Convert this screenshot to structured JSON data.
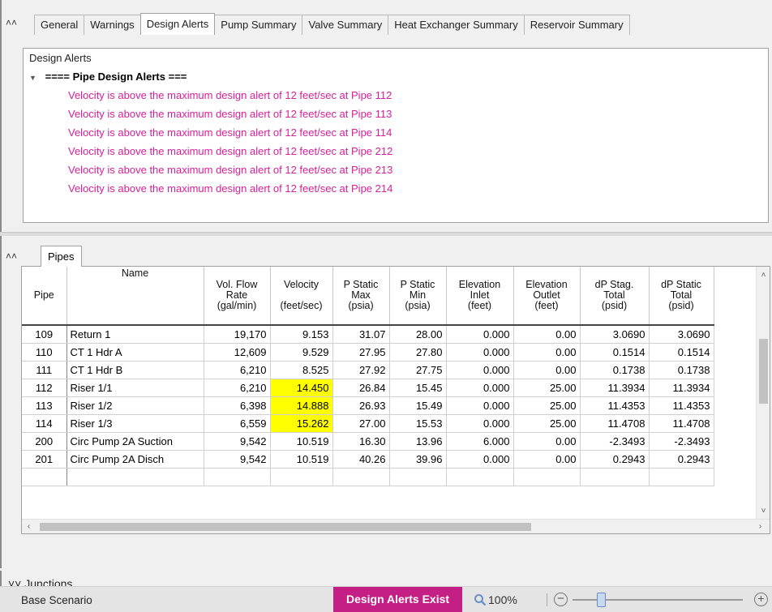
{
  "top_tabs": {
    "collapse_icon": "double-chevron-up-icon",
    "items": [
      {
        "label": "General"
      },
      {
        "label": "Warnings"
      },
      {
        "label": "Design Alerts"
      },
      {
        "label": "Pump Summary"
      },
      {
        "label": "Valve Summary"
      },
      {
        "label": "Heat Exchanger Summary"
      },
      {
        "label": "Reservoir Summary"
      }
    ],
    "active": "Design Alerts"
  },
  "design_alerts": {
    "header": "Design Alerts",
    "group_title": "==== Pipe Design Alerts ===",
    "alert_color": "#d6209a",
    "alerts": [
      "Velocity is above the maximum design alert of 12 feet/sec at Pipe 112",
      "Velocity is above the maximum design alert of 12 feet/sec at Pipe 113",
      "Velocity is above the maximum design alert of 12 feet/sec at Pipe 114",
      "Velocity is above the maximum design alert of 12 feet/sec at Pipe 212",
      "Velocity is above the maximum design alert of 12 feet/sec at Pipe 213",
      "Velocity is above the maximum design alert of 12 feet/sec at Pipe 214"
    ]
  },
  "pipes": {
    "tab_label": "Pipes",
    "columns": [
      {
        "l1": "",
        "l2": "Pipe",
        "l3": ""
      },
      {
        "l1": "Name",
        "l2": "",
        "l3": ""
      },
      {
        "l1": "Vol. Flow",
        "l2": "Rate",
        "l3": "(gal/min)"
      },
      {
        "l1": "Velocity",
        "l2": "",
        "l3": "(feet/sec)"
      },
      {
        "l1": "P Static",
        "l2": "Max",
        "l3": "(psia)"
      },
      {
        "l1": "P Static",
        "l2": "Min",
        "l3": "(psia)"
      },
      {
        "l1": "Elevation",
        "l2": "Inlet",
        "l3": "(feet)"
      },
      {
        "l1": "Elevation",
        "l2": "Outlet",
        "l3": "(feet)"
      },
      {
        "l1": "dP Stag.",
        "l2": "Total",
        "l3": "(psid)"
      },
      {
        "l1": "dP Static",
        "l2": "Total",
        "l3": "(psid)"
      }
    ],
    "highlight_color": "#ffff00",
    "rows": [
      {
        "pipe": "109",
        "name": "Return 1",
        "flow": "19,170",
        "velocity": "9.153",
        "pmax": "31.07",
        "pmin": "28.00",
        "elev_in": "0.000",
        "elev_out": "0.00",
        "dp_stag": "3.0690",
        "dp_static": "3.0690",
        "hl": false
      },
      {
        "pipe": "110",
        "name": "CT 1 Hdr A",
        "flow": "12,609",
        "velocity": "9.529",
        "pmax": "27.95",
        "pmin": "27.80",
        "elev_in": "0.000",
        "elev_out": "0.00",
        "dp_stag": "0.1514",
        "dp_static": "0.1514",
        "hl": false
      },
      {
        "pipe": "111",
        "name": "CT 1 Hdr B",
        "flow": "6,210",
        "velocity": "8.525",
        "pmax": "27.92",
        "pmin": "27.75",
        "elev_in": "0.000",
        "elev_out": "0.00",
        "dp_stag": "0.1738",
        "dp_static": "0.1738",
        "hl": false
      },
      {
        "pipe": "112",
        "name": "Riser 1/1",
        "flow": "6,210",
        "velocity": "14.450",
        "pmax": "26.84",
        "pmin": "15.45",
        "elev_in": "0.000",
        "elev_out": "25.00",
        "dp_stag": "11.3934",
        "dp_static": "11.3934",
        "hl": true
      },
      {
        "pipe": "113",
        "name": "Riser 1/2",
        "flow": "6,398",
        "velocity": "14.888",
        "pmax": "26.93",
        "pmin": "15.49",
        "elev_in": "0.000",
        "elev_out": "25.00",
        "dp_stag": "11.4353",
        "dp_static": "11.4353",
        "hl": true
      },
      {
        "pipe": "114",
        "name": "Riser 1/3",
        "flow": "6,559",
        "velocity": "15.262",
        "pmax": "27.00",
        "pmin": "15.53",
        "elev_in": "0.000",
        "elev_out": "25.00",
        "dp_stag": "11.4708",
        "dp_static": "11.4708",
        "hl": true
      },
      {
        "pipe": "200",
        "name": "Circ Pump 2A Suction",
        "flow": "9,542",
        "velocity": "10.519",
        "pmax": "16.30",
        "pmin": "13.96",
        "elev_in": "6.000",
        "elev_out": "0.00",
        "dp_stag": "-2.3493",
        "dp_static": "-2.3493",
        "hl": false
      },
      {
        "pipe": "201",
        "name": "Circ Pump 2A Disch",
        "flow": "9,542",
        "velocity": "10.519",
        "pmax": "40.26",
        "pmin": "39.96",
        "elev_in": "0.000",
        "elev_out": "0.00",
        "dp_stag": "0.2943",
        "dp_static": "0.2943",
        "hl": false
      }
    ]
  },
  "junctions": {
    "label": "Junctions",
    "icon": "double-chevron-down-icon"
  },
  "status": {
    "scenario": "Base Scenario",
    "badge": "Design Alerts Exist",
    "badge_color": "#c41f85",
    "zoom": "100%"
  }
}
